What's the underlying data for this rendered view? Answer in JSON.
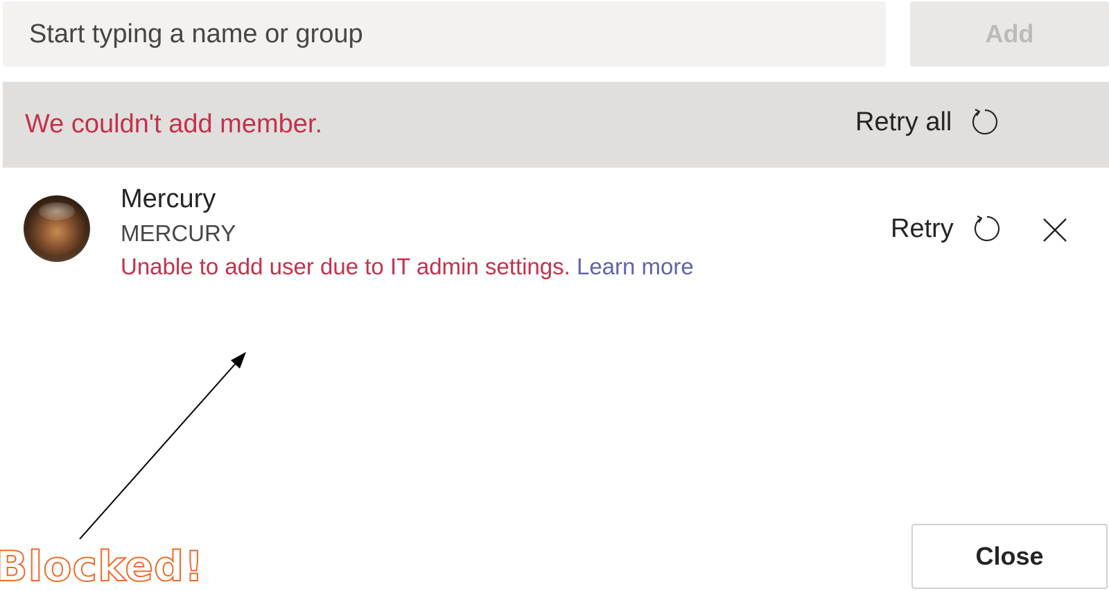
{
  "search": {
    "placeholder": "Start typing a name or group",
    "value": ""
  },
  "add_button": {
    "label": "Add"
  },
  "banner": {
    "message": "We couldn't add member.",
    "retry_all_label": "Retry all",
    "retry_icon": "refresh-icon"
  },
  "member": {
    "name": "Mercury",
    "id": "MERCURY",
    "error": "Unable to add user due to IT admin settings.",
    "learn_more": "Learn more",
    "retry_label": "Retry",
    "retry_icon": "refresh-icon",
    "remove_icon": "close-icon"
  },
  "annotation": {
    "text": "Blocked!"
  },
  "close_button": {
    "label": "Close"
  },
  "colors": {
    "error_red": "#c4314b",
    "link_purple": "#6264a7",
    "annotation_orange": "#f06a29",
    "banner_gray": "#e1dfdd",
    "input_gray": "#f3f2f1"
  }
}
